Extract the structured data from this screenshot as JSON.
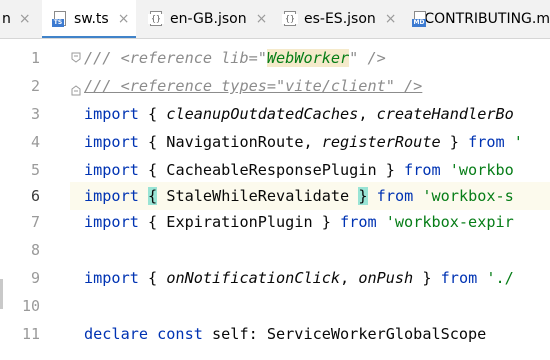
{
  "tabs": [
    {
      "label": "n",
      "icon": "none",
      "active": false
    },
    {
      "label": "sw.ts",
      "icon": "typescript-file-icon",
      "active": true
    },
    {
      "label": "en-GB.json",
      "icon": "json-file-icon",
      "active": false
    },
    {
      "label": "es-ES.json",
      "icon": "json-file-icon",
      "active": false
    },
    {
      "label": "CONTRIBUTING.m",
      "icon": "markdown-file-icon",
      "active": false
    }
  ],
  "close_glyph": "×",
  "file_badges": {
    "ts": "TS",
    "json": "{}",
    "md": "MD"
  },
  "colors": {
    "keyword": "#0033b3",
    "string": "#067d17",
    "comment": "#8c8c8c",
    "current_line": "#fcfaed",
    "active_tab_underline": "#4083c9"
  },
  "gutter": {
    "line_numbers": [
      "1",
      "2",
      "3",
      "4",
      "5",
      "6",
      "7",
      "8",
      "9",
      "10",
      "11"
    ],
    "current_line": "6"
  },
  "code": {
    "l1": {
      "a": "/// <reference lib=\"",
      "b": "WebWorker",
      "c": "\" />"
    },
    "l2": {
      "a": "/// <reference types=\"vite/client\" />"
    },
    "l3": {
      "kw": "import",
      "a": " { ",
      "b": "cleanupOutdatedCaches",
      "c": ", ",
      "d": "createHandlerBo"
    },
    "l4": {
      "kw": "import",
      "a": " { NavigationRoute, ",
      "b": "registerRoute",
      "c": " } ",
      "kw2": "from",
      "d": " '"
    },
    "l5": {
      "kw": "import",
      "a": " { CacheableResponsePlugin } ",
      "kw2": "from",
      "str": " 'workbo"
    },
    "l6": {
      "kw": "import",
      "a": " ",
      "b": "{",
      "c": " StaleWhileRevalidate ",
      "d": "}",
      "e": " ",
      "kw2": "from",
      "str": " 'workbox-s"
    },
    "l7": {
      "kw": "import",
      "a": " { ExpirationPlugin } ",
      "kw2": "from",
      "str": " 'workbox-expir"
    },
    "l8": {
      "a": ""
    },
    "l9": {
      "kw": "import",
      "a": " { ",
      "b": "onNotificationClick",
      "c": ", ",
      "d": "onPush",
      "e": " } ",
      "kw2": "from",
      "str": " './"
    },
    "l10": {
      "a": ""
    },
    "l11": {
      "kw": "declare const",
      "a": " self: ServiceWorkerGlobalScope"
    }
  }
}
